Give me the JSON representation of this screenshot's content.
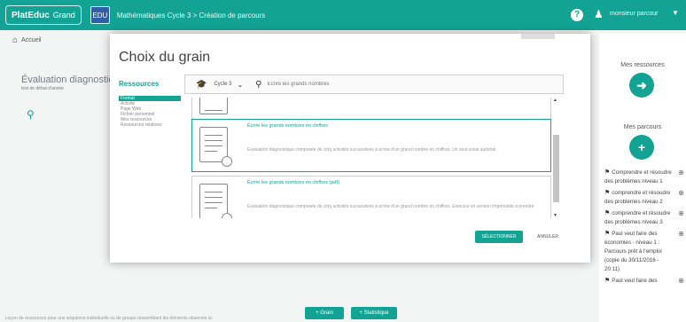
{
  "topbar": {
    "logo_brand": "PlatEduc",
    "logo_sub": "Grand",
    "app_icon_label": "EDU",
    "app_title": "Mathématiques Cycle 3 > Création de parcours",
    "help_label": "?",
    "user_name": "monsieur parcour",
    "accent": "#12a394"
  },
  "breadcrumb": {
    "home_label": "Accueil"
  },
  "page": {
    "title": "Évaluation diagnostique",
    "subtitle": "test de début d'année",
    "bottom_text": "Leçon de ressources pour une séquence individuelle ou de groupe rassemblant les éléments observés ici"
  },
  "bottom_buttons": {
    "grid_label": "+ Grain",
    "stat_label": "+ Statistique"
  },
  "right_panel": {
    "resources_title": "Mes ressources",
    "parcours_title": "Mes parcours",
    "items": [
      "Comprendre et résoudre des problèmes niveau 1",
      "comprendre et résoudre des problèmes niveau 2",
      "comprendre et résoudre des problèmes niveau 3",
      "Paul veut faire des économies - niveau 1 : Parcours prêt à l'emploi (copie du 30/11/2016 - 20:11)",
      "Paul veut faire des"
    ]
  },
  "modal": {
    "title": "Choix du grain",
    "resources_label": "Ressources",
    "filters": [
      "Format",
      "Activité",
      "Page Web",
      "Fichier personnel",
      "Mes ressources",
      "Ressources relatives"
    ],
    "cycle_value": "Cycle 3",
    "search_placeholder": "Écrire les grands nombres",
    "cards": [
      {
        "title": "Écrire les grands nombres en chiffres",
        "desc": "Évaluation diagnostique composée de cinq activités successives à écrire d'un grand nombre en chiffres. Un seul essai autorisé."
      },
      {
        "title": "Écrire les grands nombres en chiffres (pdf)",
        "desc": "Évaluation diagnostique composée de cinq activités successives à écrire d'un grand nombre en chiffres. Exercice en version imprimable à prendre"
      }
    ],
    "select_label": "SÉLECTIONNER",
    "cancel_label": "ANNULER"
  }
}
